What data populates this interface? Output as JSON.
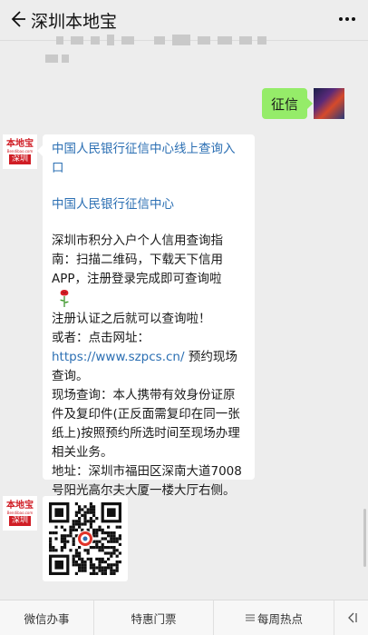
{
  "header": {
    "title": "深圳本地宝"
  },
  "outgoing": {
    "text": "征信"
  },
  "bot_avatar": {
    "brand": "本地宝",
    "domain": "Bendibao.com",
    "city": "深圳"
  },
  "reply": {
    "link_title": "中国人民银行征信中心线上查询入口",
    "link_center": "中国人民银行征信中心",
    "guide": "深圳市积分入户个人信用查询指南：扫描二维码，下载天下信用APP，注册登录完成即可查询啦",
    "after_register": "注册认证之后就可以查询啦！",
    "or_prefix": "或者：点击网址：",
    "url": "https://www.szpcs.cn/",
    "url_suffix": " 预约现场查询。",
    "onsite": "现场查询：本人携带有效身份证原件及复印件(正反面需复印在同一张纸上)按照预约所选时间至现场办理相关业务。",
    "address": "地址：深圳市福田区深南大道7008号阳光高尔夫大厦一楼大厅右侧。"
  },
  "bottom_menu": {
    "items": [
      {
        "label": "微信办事"
      },
      {
        "label": "特惠门票"
      },
      {
        "label": "每周热点"
      }
    ]
  },
  "colors": {
    "bg": "#ededed",
    "outgoing_bubble": "#95ec69",
    "link": "#2b6fb3",
    "brand_red": "#d01d25"
  }
}
